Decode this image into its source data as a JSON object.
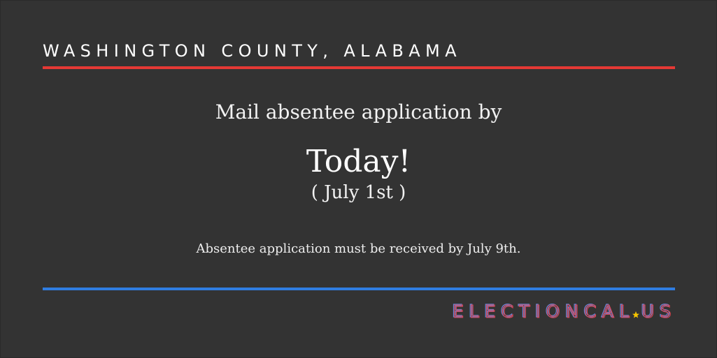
{
  "header": {
    "location": "WASHINGTON COUNTY, ALABAMA"
  },
  "main": {
    "lead": "Mail absentee application by",
    "headline": "Today!",
    "date": "( July 1st )",
    "note": "Absentee application must be received by July 9th."
  },
  "branding": {
    "logo_text": "ELECTIONCAL.US",
    "logo_word": "ELECTIONCAL",
    "logo_tld": "US"
  },
  "colors": {
    "background": "#333333",
    "accent_red": "#e53935",
    "accent_blue": "#2f7de1",
    "logo_star": "#f5c400"
  }
}
